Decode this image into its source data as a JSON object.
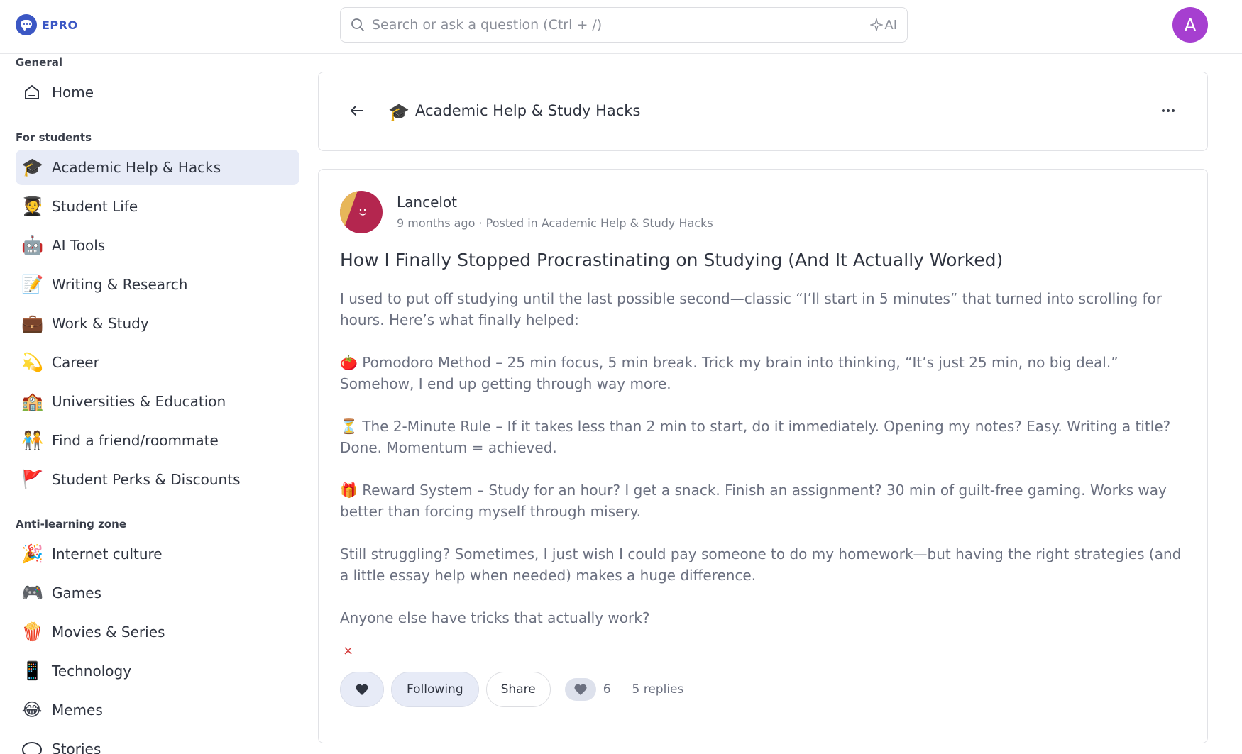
{
  "brand": {
    "name": "EPRO"
  },
  "search": {
    "placeholder": "Search or ask a question (Ctrl + /)",
    "ai_label": "AI"
  },
  "user": {
    "avatar_letter": "A",
    "avatar_color": "#a63fd0"
  },
  "sidebar": {
    "sections": [
      {
        "title": "General",
        "items": [
          {
            "label": "Home",
            "icon": "home-icon"
          }
        ]
      },
      {
        "title": "For students",
        "items": [
          {
            "label": "Academic Help & Hacks",
            "icon": "🎓",
            "active": true
          },
          {
            "label": "Student Life",
            "icon": "🧑‍🎓"
          },
          {
            "label": "AI Tools",
            "icon": "🤖"
          },
          {
            "label": "Writing & Research",
            "icon": "📝"
          },
          {
            "label": "Work & Study",
            "icon": "💼"
          },
          {
            "label": "Career",
            "icon": "💫"
          },
          {
            "label": "Universities & Education",
            "icon": "🏫"
          },
          {
            "label": "Find a friend/roommate",
            "icon": "🧑‍🤝‍🧑"
          },
          {
            "label": "Student Perks & Discounts",
            "icon": "🚩"
          }
        ]
      },
      {
        "title": "Anti-learning zone",
        "items": [
          {
            "label": "Internet culture",
            "icon": "🎉"
          },
          {
            "label": "Games",
            "icon": "🎮"
          },
          {
            "label": "Movies & Series",
            "icon": "🍿"
          },
          {
            "label": "Technology",
            "icon": "📱"
          },
          {
            "label": "Memes",
            "icon": "😂"
          },
          {
            "label": "Stories",
            "icon": "speech-bubble-icon"
          }
        ]
      }
    ]
  },
  "header": {
    "icon": "🎓",
    "title": "Academic Help & Study Hacks"
  },
  "post": {
    "author": "Lancelot",
    "meta": "9 months ago · Posted in Academic Help & Study Hacks",
    "title": "How I Finally Stopped Procrastinating on Studying (And It Actually Worked)",
    "paragraphs": [
      "I used to put off studying until the last possible second—classic “I’ll start in 5 minutes” that turned into scrolling for hours. Here’s what finally helped:",
      "🍅 Pomodoro Method – 25 min focus, 5 min break. Trick my brain into thinking, “It’s just 25 min, no big deal.” Somehow, I end up getting through way more.",
      "⏳ The 2-Minute Rule – If it takes less than 2 min to start, do it immediately. Opening my notes? Easy. Writing a title? Done. Momentum = achieved.",
      "🎁 Reward System – Study for an hour? I get a snack. Finish an assignment? 30 min of guilt-free gaming. Works way better than forcing myself through misery.",
      "Still struggling? Sometimes, I just wish I could pay someone to do my homework—but having the right strategies (and a little essay help when needed) makes a huge difference.",
      "Anyone else have tricks that actually work?"
    ],
    "close_mark": "×",
    "actions": {
      "following_label": "Following",
      "share_label": "Share",
      "like_count": "6",
      "replies_label": "5 replies"
    }
  }
}
